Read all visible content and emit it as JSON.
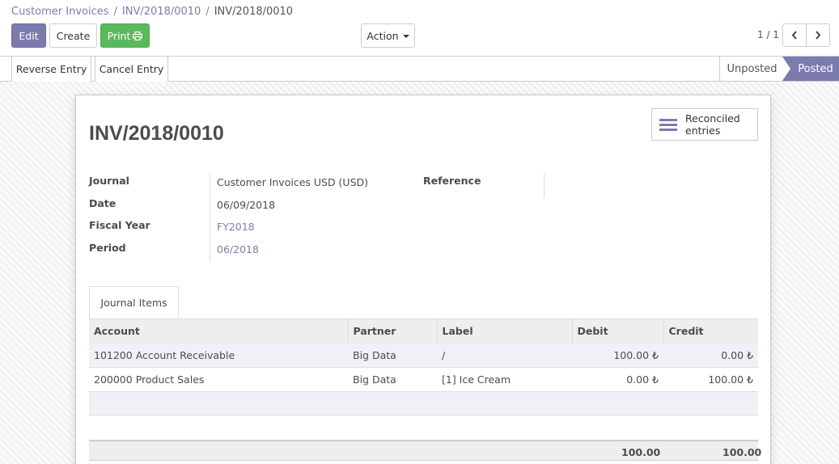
{
  "breadcrumb": [
    "Customer Invoices",
    "INV/2018/0010",
    "INV/2018/0010"
  ],
  "buttons": {
    "edit": "Edit",
    "create": "Create",
    "print": "Print",
    "action": "Action"
  },
  "pager": {
    "value": "1 / 1"
  },
  "status_buttons": {
    "reverse": "Reverse Entry",
    "cancel": "Cancel Entry"
  },
  "stages": {
    "unposted": "Unposted",
    "posted": "Posted",
    "current": "Posted"
  },
  "smart_button": {
    "label_line1": "Reconciled",
    "label_line2": "entries"
  },
  "record": {
    "title": "INV/2018/0010",
    "journal_label": "Journal",
    "journal": "Customer Invoices USD (USD)",
    "date_label": "Date",
    "date": "06/09/2018",
    "fiscal_year_label": "Fiscal Year",
    "fiscal_year": "FY2018",
    "period_label": "Period",
    "period": "06/2018",
    "reference_label": "Reference"
  },
  "tab": {
    "label": "Journal Items"
  },
  "table": {
    "columns": [
      "Account",
      "Partner",
      "Label",
      "Debit",
      "Credit"
    ],
    "rows": [
      {
        "account": "101200 Account Receivable",
        "partner": "Big Data",
        "label": "/",
        "debit": "100.00 ₺",
        "credit": "0.00 ₺"
      },
      {
        "account": "200000 Product Sales",
        "partner": "Big Data",
        "label": "[1] Ice Cream",
        "debit": "0.00 ₺",
        "credit": "100.00 ₺"
      }
    ],
    "totals": {
      "debit": "100.00",
      "credit": "100.00"
    }
  },
  "colors": {
    "primary": "#7c7bad",
    "success": "#5cb85c"
  }
}
